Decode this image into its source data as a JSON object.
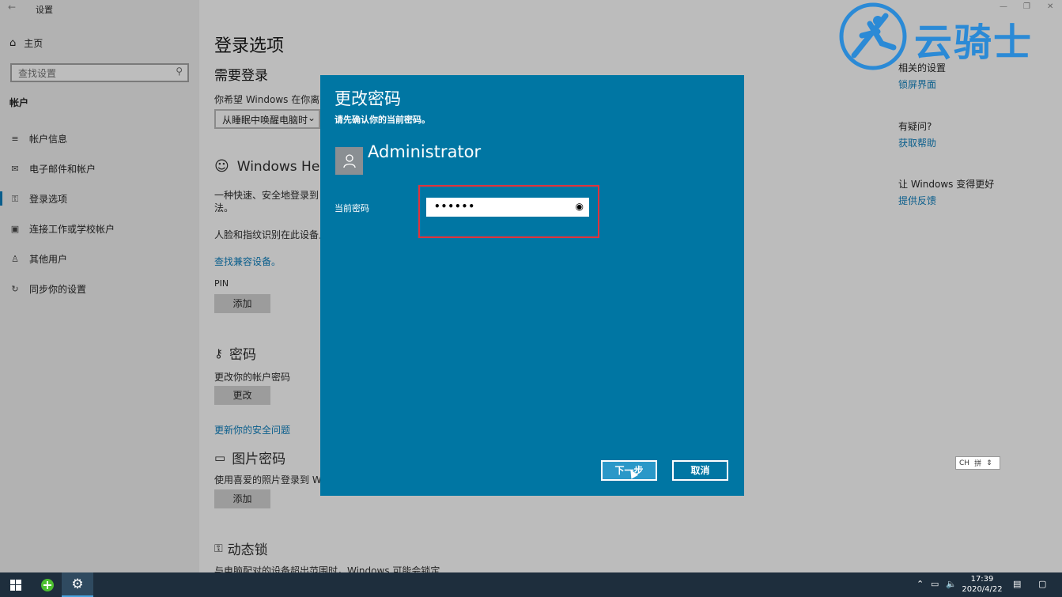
{
  "window": {
    "title": "设置",
    "back_glyph": "←"
  },
  "watermark": {
    "text": "云骑士"
  },
  "sidebar": {
    "home": "主页",
    "search_placeholder": "查找设置",
    "section": "帐户",
    "items": [
      {
        "label": "帐户信息",
        "icon": "person-card-icon"
      },
      {
        "label": "电子邮件和帐户",
        "icon": "mail-icon"
      },
      {
        "label": "登录选项",
        "icon": "key-icon"
      },
      {
        "label": "连接工作或学校帐户",
        "icon": "briefcase-icon"
      },
      {
        "label": "其他用户",
        "icon": "person-icon"
      },
      {
        "label": "同步你的设置",
        "icon": "sync-icon"
      }
    ]
  },
  "main": {
    "title": "登录选项",
    "require_signin": "需要登录",
    "require_desc": "你希望 Windows 在你离开电",
    "require_select": "从睡眠中唤醒电脑时",
    "hello_title": "Windows Hello",
    "hello_desc1": "一种快速、安全地登录到 W",
    "hello_desc2": "法。",
    "hello_face": "人脸和指纹识别在此设备上",
    "hello_link": "查找兼容设备。",
    "pin_label": "PIN",
    "pin_add": "添加",
    "password_title": "密码",
    "password_desc": "更改你的帐户密码",
    "password_change": "更改",
    "security_link": "更新你的安全问题",
    "picture_title": "图片密码",
    "picture_desc": "使用喜爱的照片登录到 Win",
    "picture_add": "添加",
    "dynlock_title": "动态锁",
    "dynlock_desc": "与电脑配对的设备超出范围时，Windows 可能会锁定"
  },
  "right": {
    "related_title": "相关的设置",
    "related_link": "锁屏界面",
    "question_title": "有疑问?",
    "question_link": "获取帮助",
    "improve_title": "让 Windows 变得更好",
    "improve_link": "提供反馈"
  },
  "dialog": {
    "title": "更改密码",
    "subtitle": "请先确认你的当前密码。",
    "username": "Administrator",
    "password_label": "当前密码",
    "password_value": "••••••",
    "next": "下一步",
    "cancel": "取消"
  },
  "ime": {
    "lang": "CH",
    "mode": "拼"
  },
  "taskbar": {
    "time": "17:39",
    "date": "2020/4/22"
  }
}
